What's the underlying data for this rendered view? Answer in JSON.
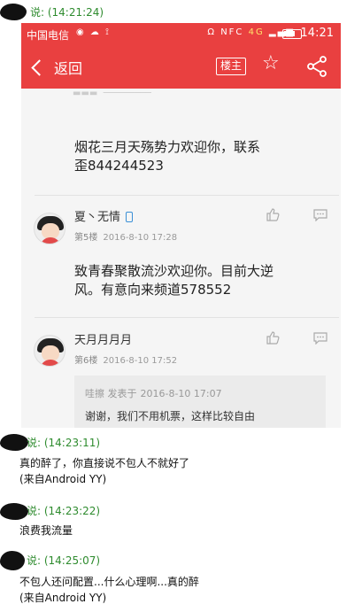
{
  "chat": {
    "msg1_header": "说: (14:21:24)",
    "msg2_header": "说: (14:23:11)",
    "msg2_line1": "真的醉了，你直接说不包人不就好了",
    "msg2_line2": "(来自Android YY)",
    "msg3_header": "说: (14:23:22)",
    "msg3_line1": "浪费我流量",
    "msg4_header": "说: (14:25:07)",
    "msg4_line1": "不包人还问配置...什么心理啊...真的醉",
    "msg4_line2": "(来自Android YY)"
  },
  "statusbar": {
    "carrier": "中国电信",
    "time": "14:21",
    "network": "4G",
    "nfc": "NFC"
  },
  "navbar": {
    "back_label": "返回",
    "op_badge": "楼主"
  },
  "posts": [
    {
      "body_line1": "烟花三月天殇势力欢迎你，联系",
      "body_line2": "歪844244523"
    },
    {
      "username": "夏丶无情",
      "floor": "第5楼",
      "time": "2016-8-10 17:28",
      "body_line1": "致青春聚散流沙欢迎你。目前大逆",
      "body_line2": "风。有意向来频道578552"
    },
    {
      "username": "天月月月月",
      "floor": "第6楼",
      "time": "2016-8-10 17:52",
      "quote_author": "哇擦 发表于",
      "quote_time": "2016-8-10 17:07",
      "quote_text": "谢谢，我们不用机票，这样比较自由"
    }
  ],
  "colors": {
    "accent": "#e94040",
    "chat_header": "#2e8b2e"
  }
}
